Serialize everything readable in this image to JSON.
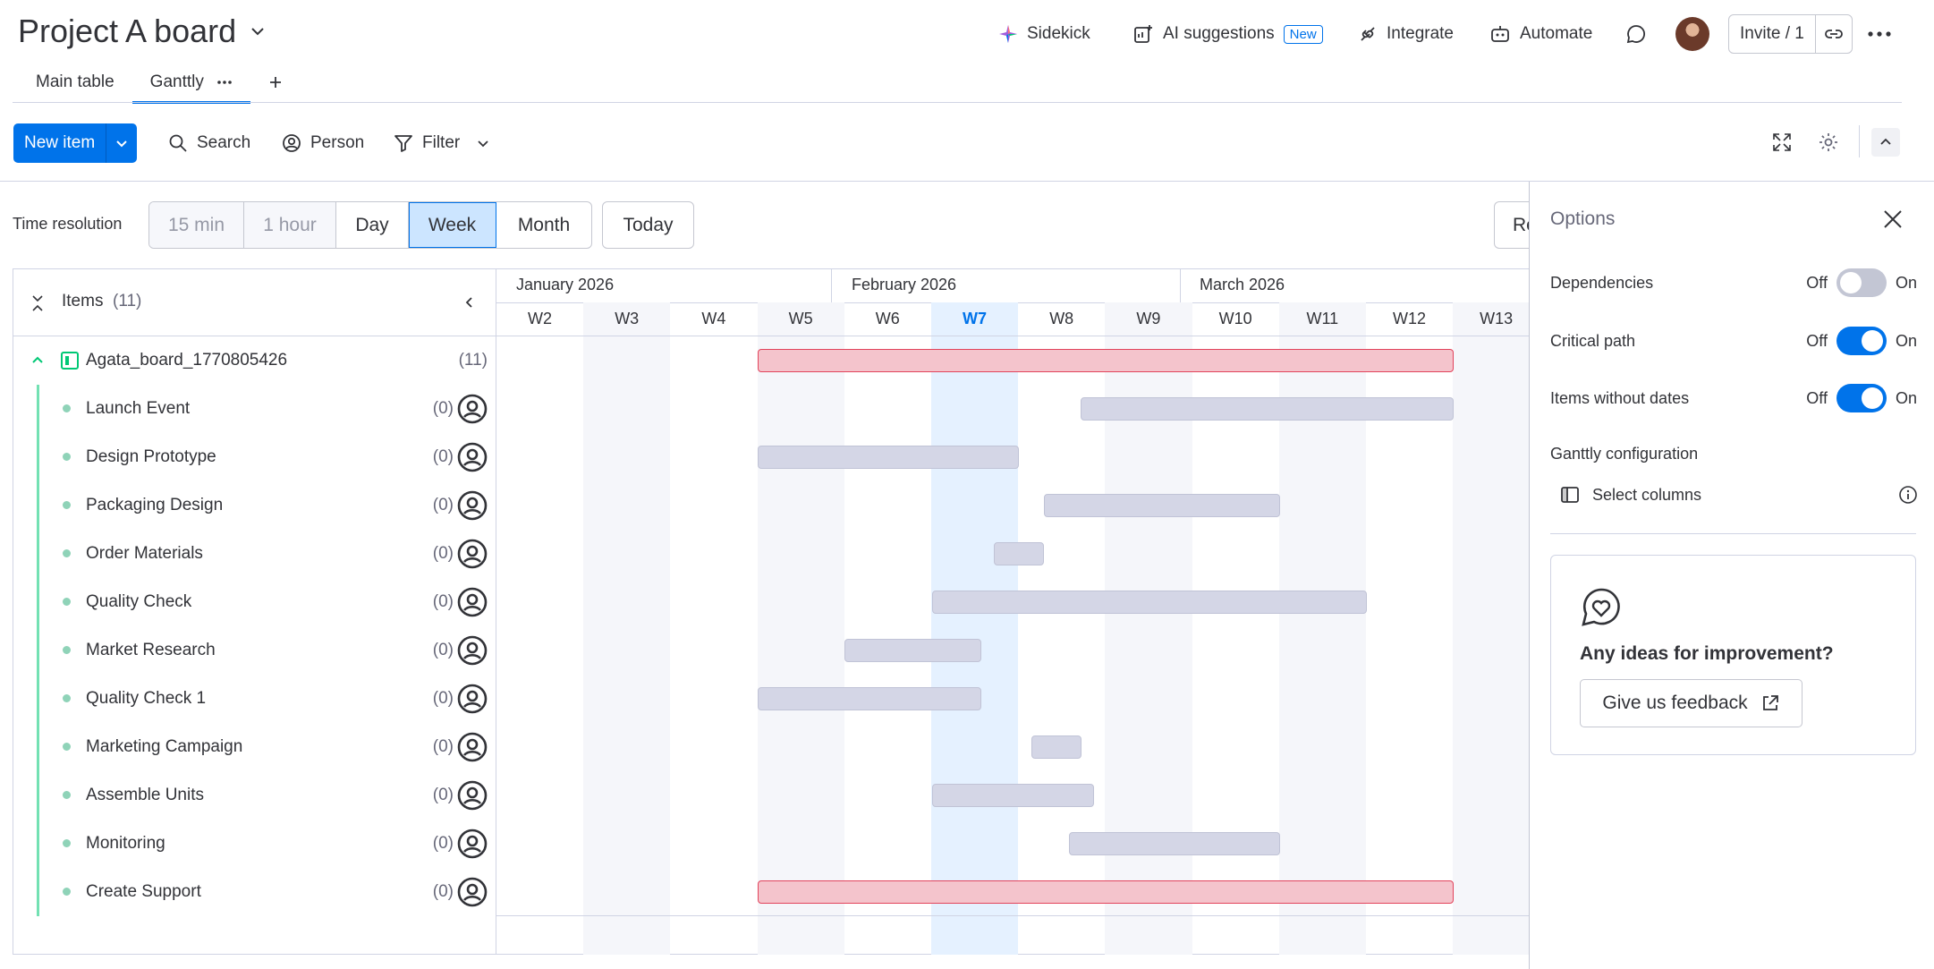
{
  "board": {
    "title": "Project A board"
  },
  "header": {
    "sidekick": "Sidekick",
    "ai_suggestions": "AI suggestions",
    "ai_badge": "New",
    "integrate": "Integrate",
    "automate": "Automate",
    "invite": "Invite / 1"
  },
  "tabs": [
    {
      "label": "Main table"
    },
    {
      "label": "Ganttly"
    }
  ],
  "toolbar": {
    "new_item": "New item",
    "search": "Search",
    "person": "Person",
    "filter": "Filter"
  },
  "time_resolution": {
    "label": "Time resolution",
    "options": [
      "15 min",
      "1 hour",
      "Day",
      "Week",
      "Month"
    ],
    "selected": "Week",
    "today": "Today",
    "re": "Re"
  },
  "items_header": {
    "label": "Items",
    "count": "(11)"
  },
  "group": {
    "name": "Agata_board_1770805426",
    "count": "(11)"
  },
  "items": [
    {
      "name": "Launch Event",
      "count": "(0)"
    },
    {
      "name": "Design Prototype",
      "count": "(0)"
    },
    {
      "name": "Packaging Design",
      "count": "(0)"
    },
    {
      "name": "Order Materials",
      "count": "(0)"
    },
    {
      "name": "Quality Check",
      "count": "(0)"
    },
    {
      "name": "Market Research",
      "count": "(0)"
    },
    {
      "name": "Quality Check 1",
      "count": "(0)"
    },
    {
      "name": "Marketing Campaign",
      "count": "(0)"
    },
    {
      "name": "Assemble Units",
      "count": "(0)"
    },
    {
      "name": "Monitoring",
      "count": "(0)"
    },
    {
      "name": "Create Support",
      "count": "(0)"
    }
  ],
  "timeline": {
    "months": [
      "January 2026",
      "February 2026",
      "March 2026"
    ],
    "weeks": [
      "W2",
      "W3",
      "W4",
      "W5",
      "W6",
      "W7",
      "W8",
      "W9",
      "W10",
      "W11",
      "W12",
      "W13"
    ],
    "current_week": "W7"
  },
  "options": {
    "title": "Options",
    "dependencies": {
      "label": "Dependencies",
      "off": "Off",
      "on": "On",
      "value": false
    },
    "critical_path": {
      "label": "Critical path",
      "off": "Off",
      "on": "On",
      "value": true
    },
    "items_without_dates": {
      "label": "Items without dates",
      "off": "Off",
      "on": "On",
      "value": true
    },
    "ganttly_configuration": "Ganttly configuration",
    "select_columns": "Select columns",
    "feedback_title": "Any ideas for improvement?",
    "feedback_button": "Give us feedback"
  },
  "colors": {
    "accent": "#0073ea",
    "critical_bar": "#f4c4cc",
    "critical_border": "#e2445c",
    "normal_bar": "#d4d6e6",
    "current_week_bg": "#e5f1ff"
  }
}
